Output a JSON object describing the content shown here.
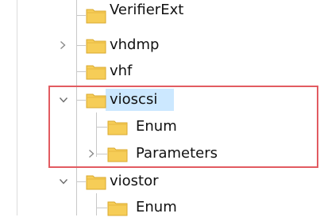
{
  "registry_tree": {
    "items": [
      {
        "label": "VerifierExt",
        "expanded": false,
        "has_children": false,
        "selected": false
      },
      {
        "label": "vhdmp",
        "expanded": false,
        "has_children": true,
        "selected": false
      },
      {
        "label": "vhf",
        "expanded": false,
        "has_children": false,
        "selected": false
      },
      {
        "label": "vioscsi",
        "expanded": true,
        "has_children": true,
        "selected": true
      },
      {
        "label": "Enum",
        "expanded": false,
        "has_children": false,
        "selected": false
      },
      {
        "label": "Parameters",
        "expanded": false,
        "has_children": true,
        "selected": false
      },
      {
        "label": "viostor",
        "expanded": true,
        "has_children": true,
        "selected": false
      },
      {
        "label": "Enum",
        "expanded": false,
        "has_children": false,
        "selected": false
      }
    ]
  },
  "colors": {
    "selection": "#cce8ff",
    "highlight_box": "#e25b61",
    "folder_fill": "#f6cd57",
    "folder_edge": "#d9a92f"
  },
  "icons": {
    "folder": "folder-icon",
    "expand": "chevron-right-icon",
    "collapse": "chevron-down-icon"
  }
}
